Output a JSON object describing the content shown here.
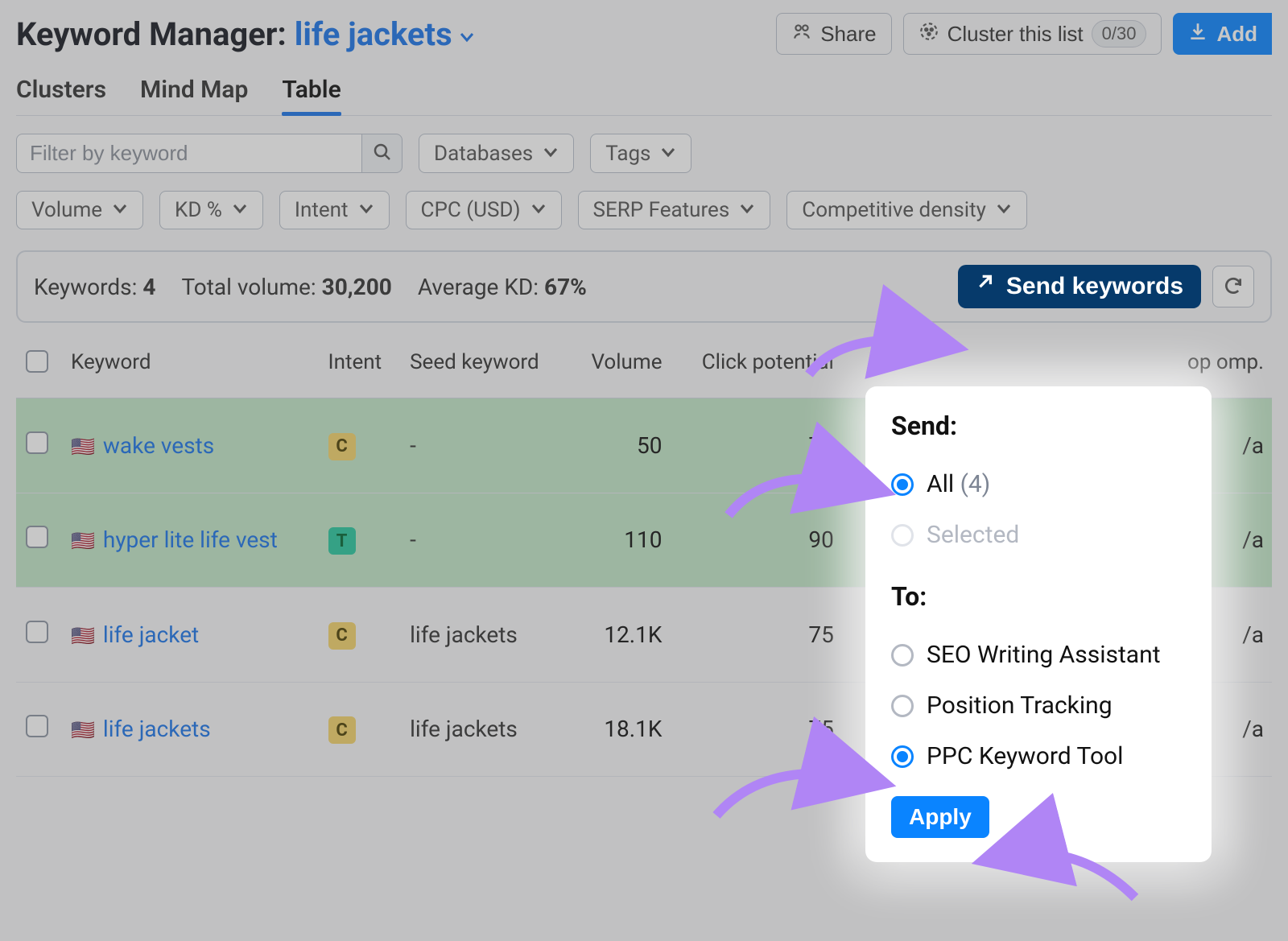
{
  "header": {
    "title": "Keyword Manager:",
    "list_name": "life jackets",
    "share_label": "Share",
    "cluster_label": "Cluster this list",
    "cluster_count": "0/30",
    "add_label": "Add"
  },
  "tabs": [
    "Clusters",
    "Mind Map",
    "Table"
  ],
  "active_tab": "Table",
  "filters": {
    "search_placeholder": "Filter by keyword",
    "databases": "Databases",
    "tags": "Tags",
    "volume": "Volume",
    "kd": "KD %",
    "intent": "Intent",
    "cpc": "CPC (USD)",
    "serp": "SERP Features",
    "competitive": "Competitive density"
  },
  "stats": {
    "keywords_label": "Keywords:",
    "keywords_value": "4",
    "volume_label": "Total volume:",
    "volume_value": "30,200",
    "kd_label": "Average KD:",
    "kd_value": "67%",
    "send_label": "Send keywords"
  },
  "columns": {
    "keyword": "Keyword",
    "intent": "Intent",
    "seed": "Seed keyword",
    "volume": "Volume",
    "click": "Click potential",
    "topcomp": "op omp."
  },
  "rows": [
    {
      "kw": "wake vests",
      "intent": "C",
      "intent_class": "",
      "seed": "-",
      "volume": "50",
      "click": "75",
      "comp": "/a",
      "lime": true
    },
    {
      "kw": "hyper lite life vest",
      "intent": "T",
      "intent_class": "t",
      "seed": "-",
      "volume": "110",
      "click": "90",
      "comp": "/a",
      "lime": true
    },
    {
      "kw": "life jacket",
      "intent": "C",
      "intent_class": "",
      "seed": "life jackets",
      "volume": "12.1K",
      "click": "75",
      "comp": "/a",
      "lime": false
    },
    {
      "kw": "life jackets",
      "intent": "C",
      "intent_class": "",
      "seed": "life jackets",
      "volume": "18.1K",
      "click": "75",
      "comp": "/a",
      "lime": false
    }
  ],
  "popover": {
    "send_heading": "Send:",
    "all_label": "All",
    "all_count": "(4)",
    "selected_label": "Selected",
    "to_heading": "To:",
    "opt1": "SEO Writing Assistant",
    "opt2": "Position Tracking",
    "opt3": "PPC Keyword Tool",
    "apply": "Apply"
  }
}
